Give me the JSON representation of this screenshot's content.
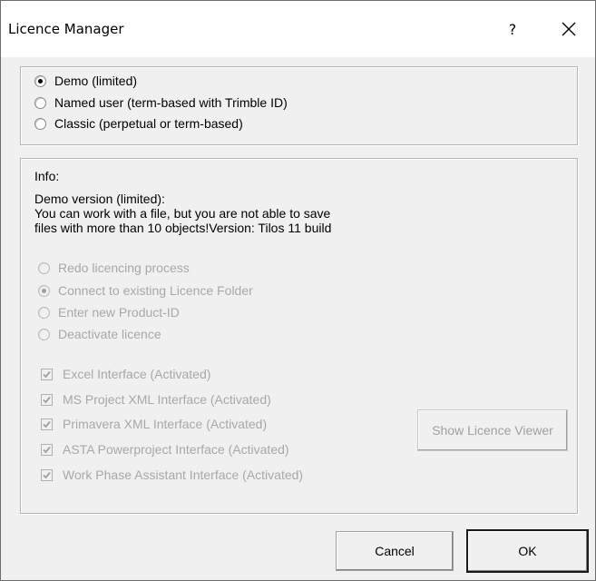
{
  "window": {
    "title": "Licence Manager",
    "help_label": "?"
  },
  "licence_type": {
    "options": [
      {
        "label": "Demo (limited)",
        "selected": true
      },
      {
        "label": "Named user (term-based with Trimble ID)",
        "selected": false
      },
      {
        "label": "Classic (perpetual or term-based)",
        "selected": false
      }
    ]
  },
  "info": {
    "label": "Info:",
    "lines": [
      "Demo version (limited):",
      "You can work with a file, but you are not able to save",
      "files with more than 10 objects!Version: Tilos 11 build"
    ],
    "actions": [
      {
        "label": "Redo licencing process",
        "selected": false,
        "enabled": false
      },
      {
        "label": "Connect to existing Licence Folder",
        "selected": true,
        "enabled": false
      },
      {
        "label": "Enter new Product-ID",
        "selected": false,
        "enabled": false
      },
      {
        "label": "Deactivate licence",
        "selected": false,
        "enabled": false
      }
    ],
    "interfaces": [
      {
        "label": "Excel Interface (Activated)",
        "checked": true,
        "enabled": false
      },
      {
        "label": "MS Project XML Interface (Activated)",
        "checked": true,
        "enabled": false
      },
      {
        "label": "Primavera XML Interface (Activated)",
        "checked": true,
        "enabled": false
      },
      {
        "label": "ASTA Powerproject Interface (Activated)",
        "checked": true,
        "enabled": false
      },
      {
        "label": "Work Phase Assistant Interface (Activated)",
        "checked": true,
        "enabled": false
      }
    ],
    "viewer_button": "Show Licence Viewer"
  },
  "footer": {
    "cancel_label": "Cancel",
    "ok_label": "OK"
  },
  "colors": {
    "dialog_bg": "#f0f0f0",
    "disabled_text": "#a8a8a8"
  }
}
